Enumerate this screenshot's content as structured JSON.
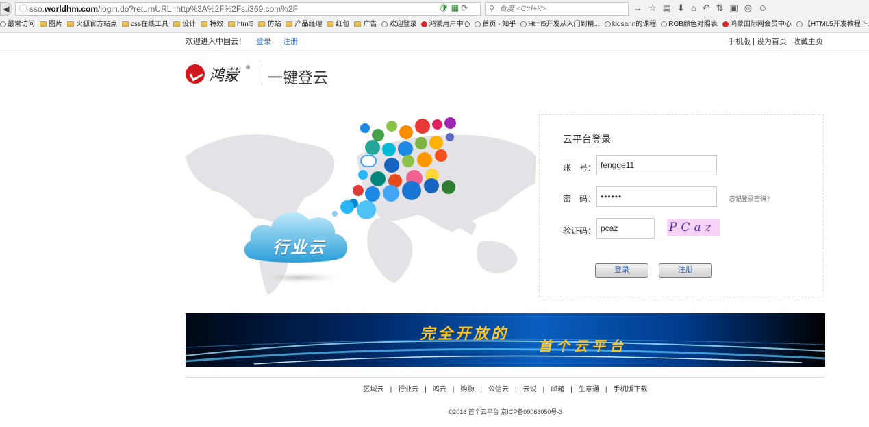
{
  "browser": {
    "url_host_prefix": "sso.",
    "url_host": "worldhm.com",
    "url_path": "/login.do?returnURL=http%3A%2F%2Fs.i369.com%2F",
    "search_placeholder": "百度 <Ctrl+K>",
    "bookmarks": [
      "最常访问",
      "图片",
      "火狐官方站点",
      "css在线工具",
      "设计",
      "特效",
      "html5",
      "仿站",
      "产品经理",
      "红包",
      "广告",
      "欢迎登录",
      "鸿蒙用户中心",
      "首页 - 知乎",
      "Html5开发从入门到精...",
      "kidsann的课程",
      "RGB颜色对照表",
      "鸿蒙国际网会员中心",
      "【HTML5开发教程下..."
    ]
  },
  "topbar": {
    "welcome": "欢迎进入中国云！",
    "login": "登录",
    "register": "注册",
    "right_links": "手机版 | 设为首页 | 收藏主页"
  },
  "header": {
    "logo_text": "鸿蒙",
    "logo_reg": "®",
    "slogan": "一键登云"
  },
  "hero": {
    "cloud_label": "行业云"
  },
  "login": {
    "title": "云平台登录",
    "account_label": "账　号：",
    "account_value": "fengge11",
    "password_label": "密　码：",
    "password_value": "••••••",
    "forgot": "忘记登录密码?",
    "captcha_label": "验证码：",
    "captcha_value": "pcaz",
    "captcha_image_text": "PCaz",
    "login_button": "登录",
    "register_button": "注册"
  },
  "banner": {
    "text1": "完全开放的",
    "text2": "首个云平台"
  },
  "footer": {
    "links": [
      "区域云",
      "行业云",
      "鸿云",
      "购物",
      "公信云",
      "云说",
      "邮箱",
      "生意通",
      "手机版下载"
    ],
    "copyright": "©2016 首个云平台 京ICP备09066050号-3"
  },
  "colors": {
    "accent_blue": "#3a7bd5",
    "logo_red": "#d2161e",
    "banner_gold": "#ffc21a",
    "captcha_bg": "#f6d2f6"
  }
}
